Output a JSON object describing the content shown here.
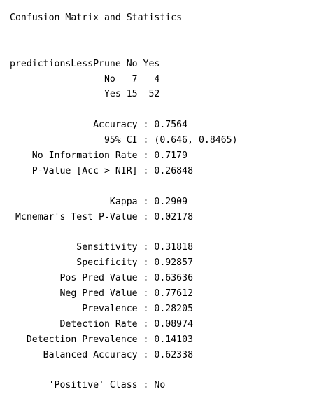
{
  "lines": [
    "Confusion Matrix and Statistics",
    "",
    "",
    "predictionsLessPrune No Yes",
    "                 No   7   4",
    "                 Yes 15  52",
    "",
    "               Accuracy : 0.7564",
    "                 95% CI : (0.646, 0.8465)",
    "    No Information Rate : 0.7179",
    "    P-Value [Acc > NIR] : 0.26848",
    "",
    "                  Kappa : 0.2909",
    " Mcnemar's Test P-Value : 0.02178",
    "",
    "            Sensitivity : 0.31818",
    "            Specificity : 0.92857",
    "         Pos Pred Value : 0.63636",
    "         Neg Pred Value : 0.77612",
    "             Prevalence : 0.28205",
    "         Detection Rate : 0.08974",
    "   Detection Prevalence : 0.14103",
    "      Balanced Accuracy : 0.62338",
    "",
    "       'Positive' Class : No"
  ]
}
